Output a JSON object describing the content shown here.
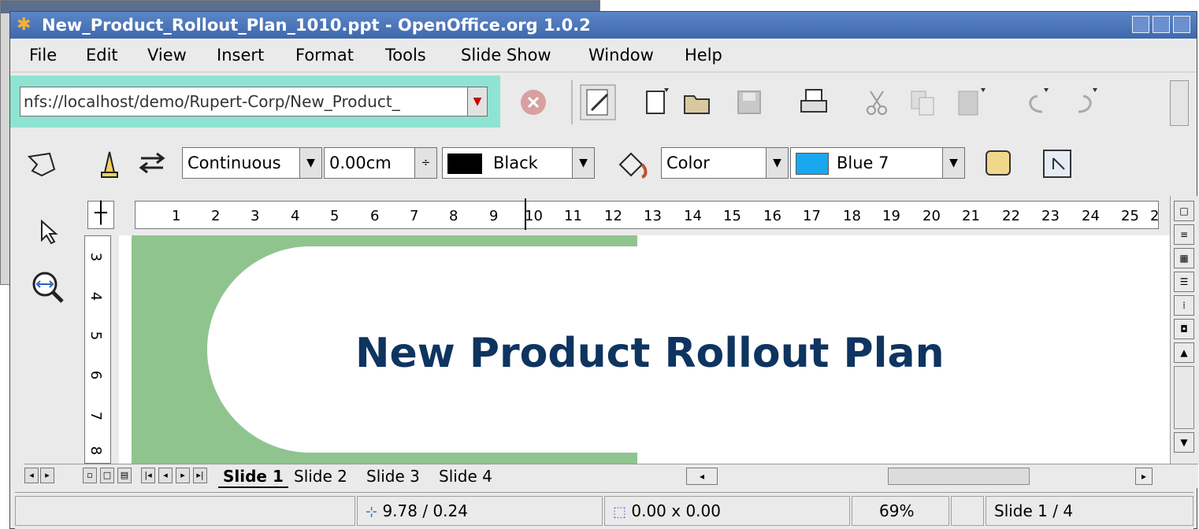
{
  "window": {
    "title": "New_Product_Rollout_Plan_1010.ppt - OpenOffice.org 1.0.2"
  },
  "menu": [
    "File",
    "Edit",
    "View",
    "Insert",
    "Format",
    "Tools",
    "Slide Show",
    "Window",
    "Help"
  ],
  "url": {
    "value": "nfs://localhost/demo/Rupert-Corp/New_Product_"
  },
  "toolbar1_icons": [
    "stop-load-icon",
    "edit-file-icon",
    "new-document-icon",
    "open-folder-icon",
    "save-icon",
    "print-icon",
    "cut-icon",
    "copy-icon",
    "paste-icon",
    "undo-icon",
    "redo-icon"
  ],
  "line": {
    "style": "Continuous",
    "width": "0.00cm",
    "color_name": "Black",
    "color_hex": "#000000"
  },
  "area": {
    "style": "Color",
    "color_name": "Blue 7",
    "color_hex": "#19a8f0"
  },
  "ruler": {
    "horizontal": [
      "1",
      "2",
      "3",
      "4",
      "5",
      "6",
      "7",
      "8",
      "9",
      "10",
      "11",
      "12",
      "13",
      "14",
      "15",
      "16",
      "17",
      "18",
      "19",
      "20",
      "21",
      "22",
      "23",
      "24",
      "25",
      "2"
    ],
    "vertical": [
      "3",
      "4",
      "5",
      "6",
      "7",
      "8"
    ]
  },
  "slide": {
    "title": "New Product Rollout Plan",
    "title_color": "#0e3460",
    "accent_color": "#8fc48f"
  },
  "tabs": [
    "Slide 1",
    "Slide 2",
    "Slide 3",
    "Slide 4"
  ],
  "status": {
    "position": "9.78 / 0.24",
    "size": "0.00 x 0.00",
    "zoom": "69%",
    "page": "Slide 1 / 4"
  }
}
